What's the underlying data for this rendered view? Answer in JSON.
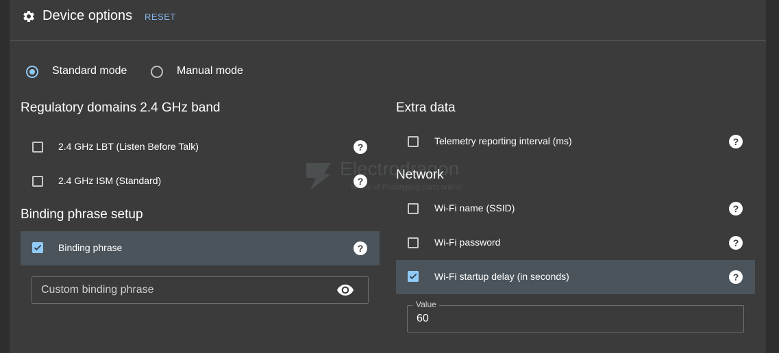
{
  "header": {
    "title": "Device options",
    "reset_label": "RESET"
  },
  "mode": {
    "standard_label": "Standard mode",
    "manual_label": "Manual mode",
    "selected": "standard"
  },
  "regulatory": {
    "title": "Regulatory domains 2.4 GHz band",
    "items": [
      {
        "label": "2.4 GHz LBT (Listen Before Talk)",
        "checked": false
      },
      {
        "label": "2.4 GHz ISM (Standard)",
        "checked": false
      }
    ]
  },
  "binding": {
    "title": "Binding phrase setup",
    "checkbox_label": "Binding phrase",
    "checked": true,
    "input_placeholder": "Custom binding phrase"
  },
  "extra": {
    "title": "Extra data",
    "items": [
      {
        "label": "Telemetry reporting interval (ms)",
        "checked": false
      }
    ]
  },
  "network": {
    "title": "Network",
    "items": [
      {
        "label": "Wi-Fi name (SSID)",
        "checked": false
      },
      {
        "label": "Wi-Fi password",
        "checked": false
      },
      {
        "label": "Wi-Fi startup delay (in seconds)",
        "checked": true
      }
    ],
    "value_field": {
      "label": "Value",
      "value": "60"
    }
  },
  "watermark": {
    "line1": "Electrodragon",
    "line2": "Whole of Prototyping parts online!"
  },
  "colors": {
    "accent": "#90caf9",
    "link": "#82b6ea",
    "highlight_row": "#4b545b",
    "background": "#3b3b3b"
  },
  "icons": {
    "settings": "gear-icon",
    "help": "help-circle-icon",
    "visibility": "eye-icon",
    "check": "check-icon"
  }
}
